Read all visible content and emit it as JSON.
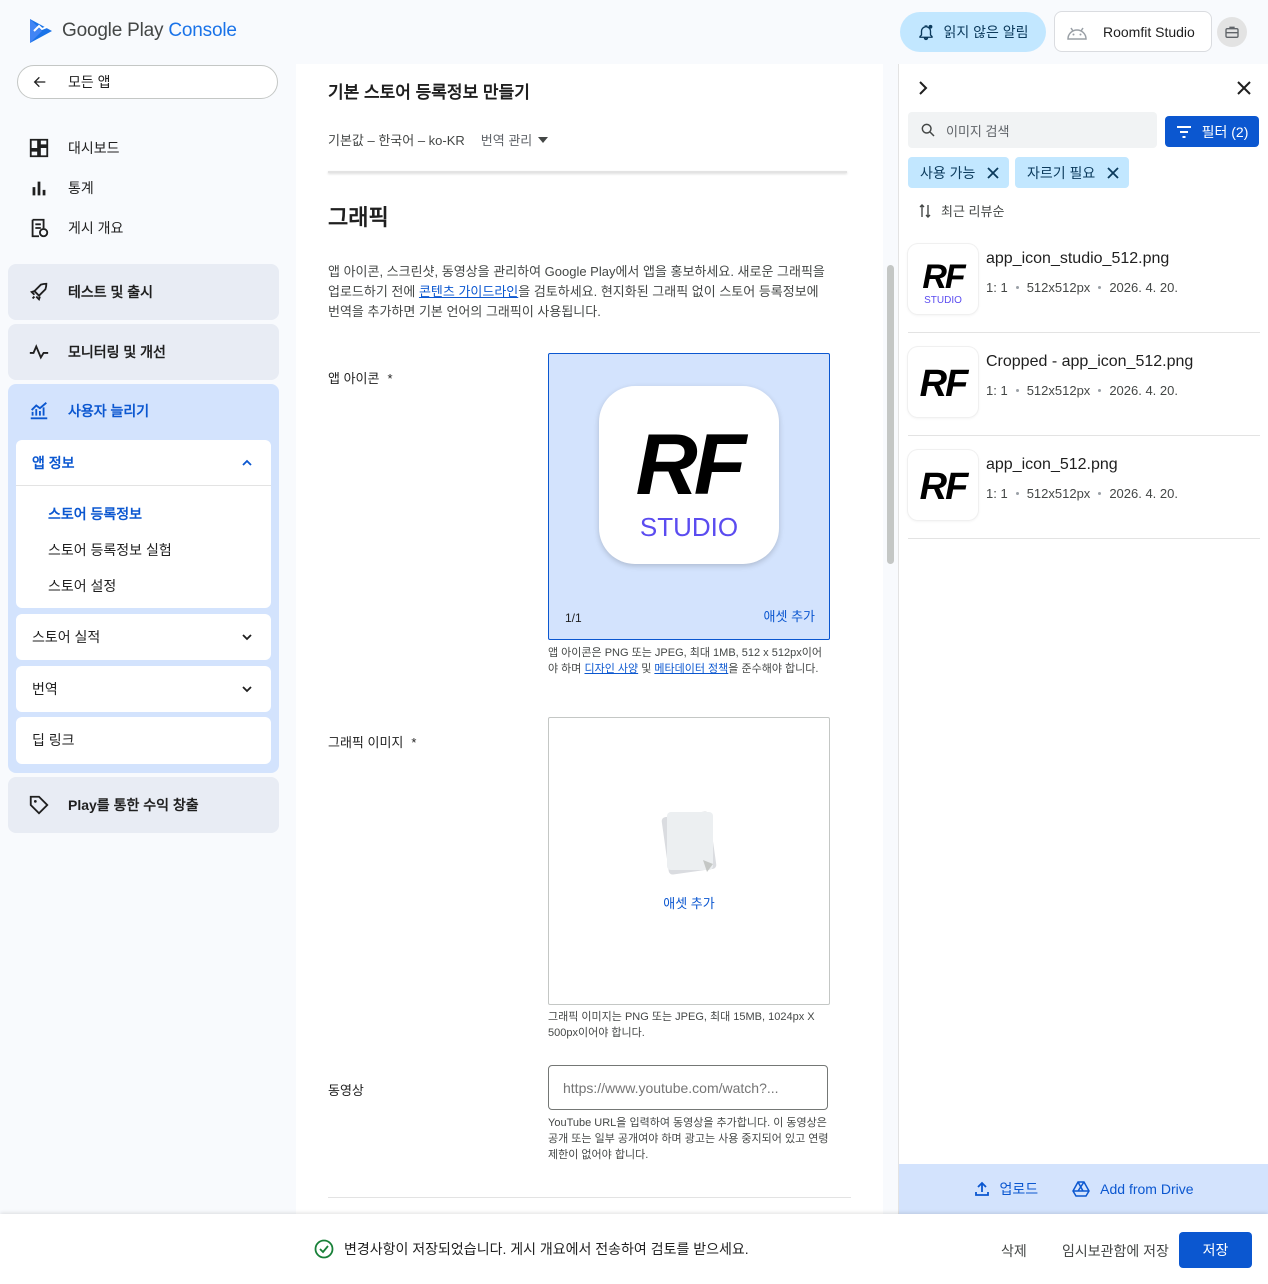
{
  "header": {
    "logo_google_play": "Google Play",
    "logo_console": "Console",
    "notifications_label": "읽지 않은 알림",
    "developer_name": "Roomfit Studio"
  },
  "sidebar": {
    "all_apps": "모든 앱",
    "items": [
      "대시보드",
      "통계",
      "게시 개요"
    ],
    "groups": {
      "test_release": "테스트 및 출시",
      "monitor": "모니터링 및 개선",
      "grow": "사용자 늘리기",
      "monetize": "Play를 통한 수익 창출"
    },
    "app_info": "앱 정보",
    "app_info_links": [
      "스토어 등록정보",
      "스토어 등록정보 실험",
      "스토어 설정"
    ],
    "store_performance": "스토어 실적",
    "translations": "번역",
    "deep_links": "딥 링크"
  },
  "main": {
    "title": "기본 스토어 등록정보 만들기",
    "language": "기본값 – 한국어 – ko-KR",
    "manage_translations": "번역 관리",
    "section_title": "그래픽",
    "desc_1": "앱 아이콘, 스크린샷, 동영상을 관리하여 Google Play에서 앱을 홍보하세요. 새로운 그래픽을 업로드하기 전에 ",
    "desc_link": "콘텐츠 가이드라인",
    "desc_2": "을 검토하세요. 현지화된 그래픽 없이 스토어 등록정보에 번역을 추가하면 기본 언어의 그래픽이 사용됩니다.",
    "app_icon_label": "앱 아이콘",
    "required_mark": "*",
    "icon_count": "1/1",
    "add_asset": "애셋 추가",
    "icon_logo_letters": "RF",
    "icon_logo_sub": "STUDIO",
    "icon_hint_1": "앱 아이콘은 PNG 또는 JPEG, 최대 1MB, 512 x 512px이어야 하며 ",
    "icon_hint_link1": "디자인 사양",
    "icon_hint_mid": " 및 ",
    "icon_hint_link2": "메타데이터 정책",
    "icon_hint_2": "을 준수해야 합니다.",
    "graphic_label": "그래픽 이미지",
    "graphic_hint": "그래픽 이미지는 PNG 또는 JPEG, 최대 15MB, 1024px X 500px이어야 합니다.",
    "video_label": "동영상",
    "video_placeholder": "https://www.youtube.com/watch?...",
    "video_hint": "YouTube URL을 입력하여 동영상을 추가합니다. 이 동영상은 공개 또는 일부 공개여야 하며 광고는 사용 중지되어 있고 연령 제한이 없어야 합니다."
  },
  "panel": {
    "search_placeholder": "이미지 검색",
    "filter_label": "필터 (2)",
    "chips": [
      "사용 가능",
      "자르기 필요"
    ],
    "sort_label": "최근 리뷰순",
    "assets": [
      {
        "name": "app_icon_studio_512.png",
        "ratio": "1:  1",
        "size": "512x512px",
        "date": "2026. 4. 20."
      },
      {
        "name": "Cropped - app_icon_512.png",
        "ratio": "1:  1",
        "size": "512x512px",
        "date": "2026. 4. 20."
      },
      {
        "name": "app_icon_512.png",
        "ratio": "1:  1",
        "size": "512x512px",
        "date": "2026. 4. 20."
      }
    ],
    "upload": "업로드",
    "add_from_drive": "Add from Drive"
  },
  "footer": {
    "saved_message": "변경사항이 저장되었습니다. 게시 개요에서 전송하여 검토를 받으세요.",
    "delete": "삭제",
    "save_draft": "임시보관함에 저장",
    "save": "저장"
  },
  "colors": {
    "accent": "#0b57d0",
    "rf_purple": "#5b4cf0",
    "chip_bg": "#c2e7ff",
    "selected_bg": "#d3e3fd"
  }
}
